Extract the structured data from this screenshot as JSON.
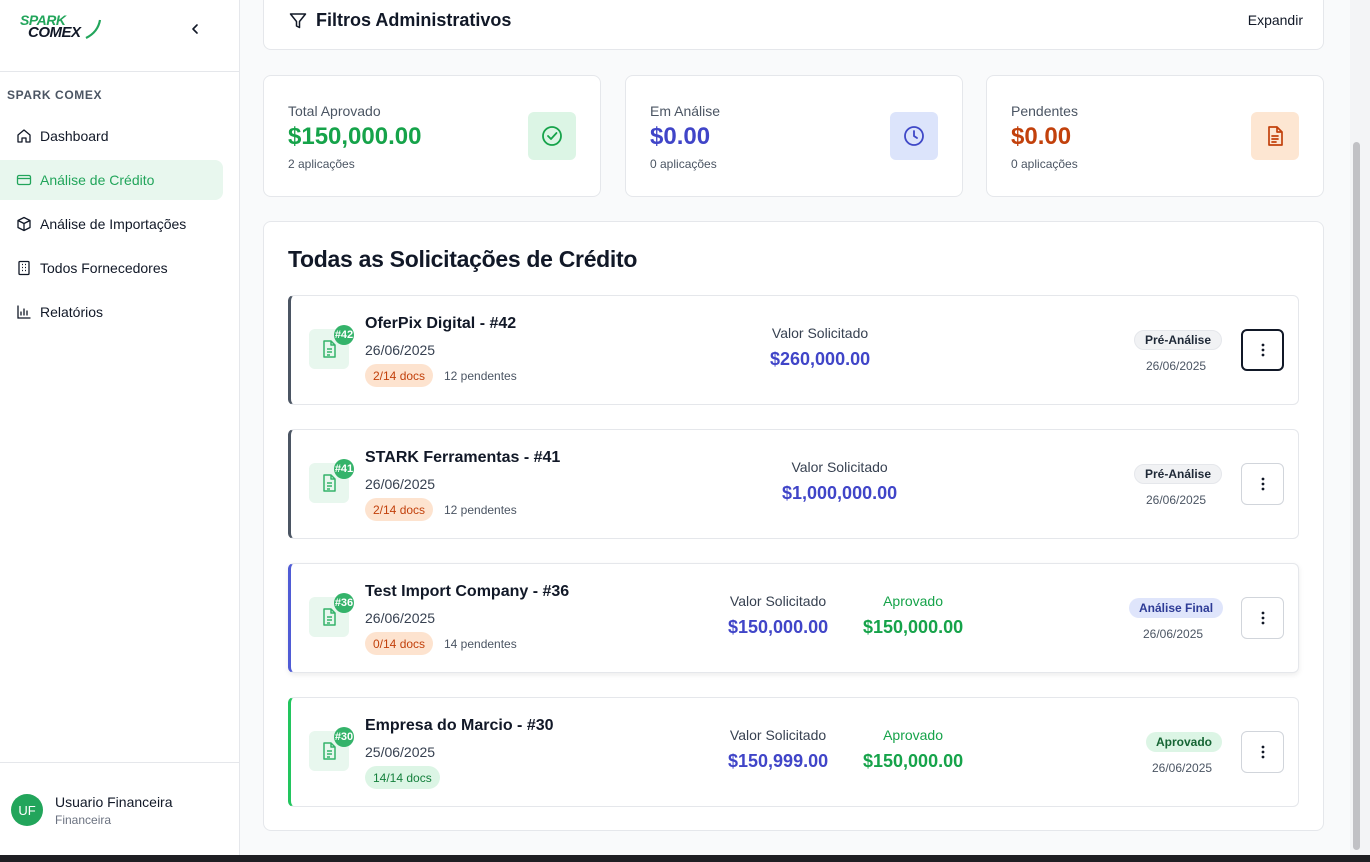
{
  "brand": {
    "logo_line1": "SPARK",
    "logo_line2": "COMEX",
    "section_label": "SPARK COMEX"
  },
  "sidebar": {
    "items": [
      {
        "label": "Dashboard",
        "icon": "home-icon"
      },
      {
        "label": "Análise de Crédito",
        "icon": "credit-card-icon",
        "active": true
      },
      {
        "label": "Análise de Importações",
        "icon": "package-icon"
      },
      {
        "label": "Todos Fornecedores",
        "icon": "building-icon"
      },
      {
        "label": "Relatórios",
        "icon": "bar-chart-icon"
      }
    ]
  },
  "user": {
    "initials": "UF",
    "name": "Usuario Financeira",
    "role": "Financeira"
  },
  "filters": {
    "title": "Filtros Administrativos",
    "expand_label": "Expandir"
  },
  "stats": [
    {
      "label": "Total Aprovado",
      "value": "$150,000.00",
      "sub": "2 aplicações",
      "color": "#16a34a",
      "icon": "check-circle-icon"
    },
    {
      "label": "Em Análise",
      "value": "$0.00",
      "sub": "0 aplicações",
      "color": "#4045c8",
      "icon": "clock-icon"
    },
    {
      "label": "Pendentes",
      "value": "$0.00",
      "sub": "0 aplicações",
      "color": "#c2410c",
      "icon": "file-text-icon"
    }
  ],
  "requests_title": "Todas as Solicitações de Crédito",
  "requests": [
    {
      "badge": "#42",
      "name": "OferPix Digital - #42",
      "date": "26/06/2025",
      "docs": "2/14 docs",
      "pending": "12 pendentes",
      "requested_label": "Valor Solicitado",
      "requested": "$260,000.00",
      "status": "Pré-Análise",
      "status_date": "26/06/2025"
    },
    {
      "badge": "#41",
      "name": "STARK Ferramentas - #41",
      "date": "26/06/2025",
      "docs": "2/14 docs",
      "pending": "12 pendentes",
      "requested_label": "Valor Solicitado",
      "requested": "$1,000,000.00",
      "status": "Pré-Análise",
      "status_date": "26/06/2025"
    },
    {
      "badge": "#36",
      "name": "Test Import Company - #36",
      "date": "26/06/2025",
      "docs": "0/14 docs",
      "pending": "14 pendentes",
      "requested_label": "Valor Solicitado",
      "requested": "$150,000.00",
      "approved_label": "Aprovado",
      "approved": "$150,000.00",
      "status": "Análise Final",
      "status_date": "26/06/2025"
    },
    {
      "badge": "#30",
      "name": "Empresa do Marcio - #30",
      "date": "25/06/2025",
      "docs": "14/14 docs",
      "requested_label": "Valor Solicitado",
      "requested": "$150,999.00",
      "approved_label": "Aprovado",
      "approved": "$150,000.00",
      "status": "Aprovado",
      "status_date": "26/06/2025"
    }
  ]
}
